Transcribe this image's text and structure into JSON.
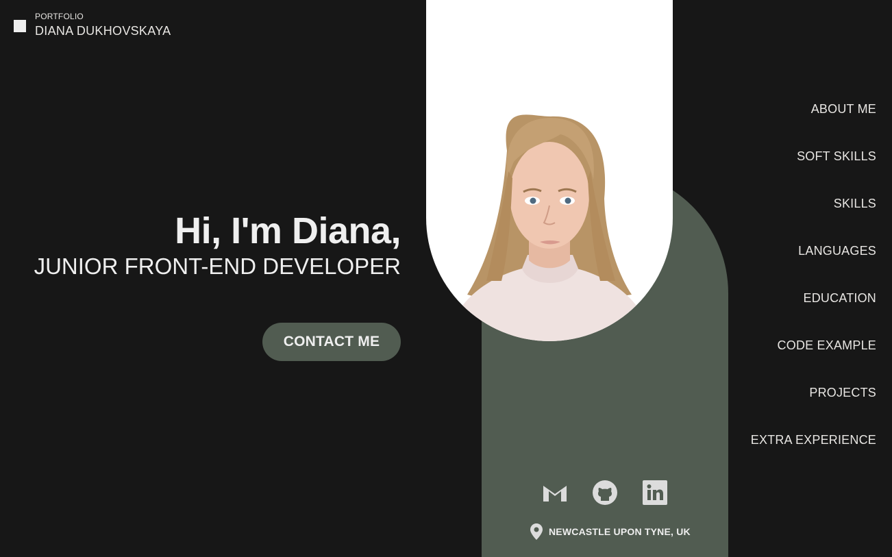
{
  "brand": {
    "kicker": "PORTFOLIO",
    "name": "DIANA DUKHOVSKAYA"
  },
  "hero": {
    "greeting": "Hi, I'm Diana,",
    "role": "JUNIOR FRONT-END DEVELOPER",
    "cta": "CONTACT ME"
  },
  "nav": {
    "items": [
      {
        "label": "ABOUT ME"
      },
      {
        "label": "SOFT SKILLS"
      },
      {
        "label": "SKILLS"
      },
      {
        "label": "LANGUAGES"
      },
      {
        "label": "EDUCATION"
      },
      {
        "label": "CODE EXAMPLE"
      },
      {
        "label": "PROJECTS"
      },
      {
        "label": "EXTRA EXPERIENCE"
      }
    ]
  },
  "social": {
    "icons": [
      "gmail-icon",
      "github-icon",
      "linkedin-icon"
    ]
  },
  "location": {
    "icon": "map-pin-icon",
    "text": "NEWCASTLE UPON TYNE, UK"
  },
  "colors": {
    "background": "#171717",
    "accent_green": "#515c51",
    "text": "#e8e6e3",
    "photo_background": "#ffffff"
  }
}
